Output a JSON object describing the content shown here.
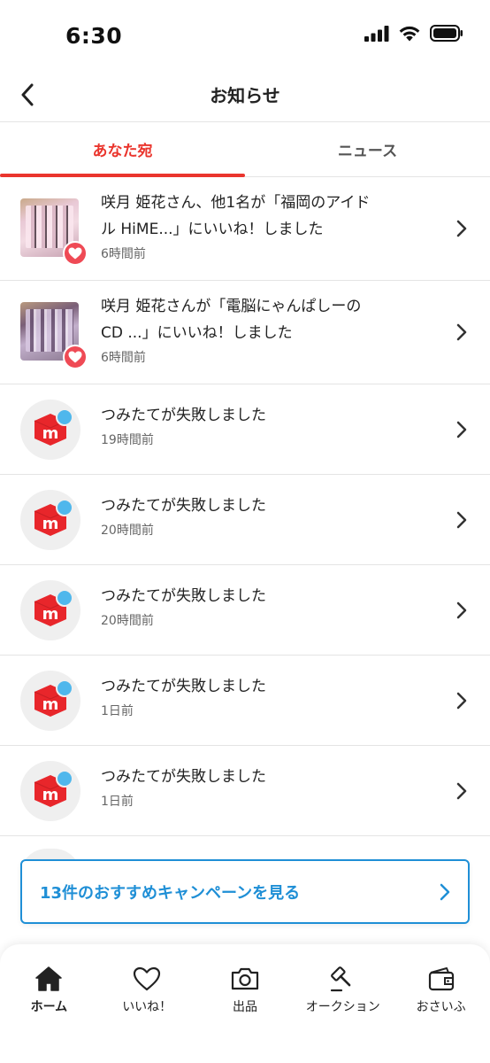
{
  "status_bar": {
    "time": "6:30"
  },
  "header": {
    "title": "お知らせ"
  },
  "tabs": [
    {
      "label": "あなた宛",
      "active": true
    },
    {
      "label": "ニュース",
      "active": false
    }
  ],
  "notifications": [
    {
      "kind": "like",
      "line1": "咲月 姫花さん、他1名が「福岡のアイド",
      "line2": "ル HiME...」にいいね！しました",
      "time": "6時間前"
    },
    {
      "kind": "like",
      "line1": "咲月 姫花さんが「電脳にゃんぱしーの",
      "line2": "CD ...」にいいね！しました",
      "time": "6時間前"
    },
    {
      "kind": "system",
      "line1": "つみたてが失敗しました",
      "time": "19時間前"
    },
    {
      "kind": "system",
      "line1": "つみたてが失敗しました",
      "time": "20時間前"
    },
    {
      "kind": "system",
      "line1": "つみたてが失敗しました",
      "time": "20時間前"
    },
    {
      "kind": "system",
      "line1": "つみたてが失敗しました",
      "time": "1日前"
    },
    {
      "kind": "system",
      "line1": "つみたてが失敗しました",
      "time": "1日前"
    }
  ],
  "campaign": {
    "label": "13件のおすすめキャンペーンを見る"
  },
  "bottom_nav": [
    {
      "label": "ホーム",
      "icon": "home-icon",
      "active": true
    },
    {
      "label": "いいね！",
      "icon": "heart-icon",
      "active": false
    },
    {
      "label": "出品",
      "icon": "camera-icon",
      "active": false
    },
    {
      "label": "オークション",
      "icon": "gavel-icon",
      "active": false
    },
    {
      "label": "おさいふ",
      "icon": "wallet-icon",
      "active": false
    }
  ],
  "colors": {
    "accent_red": "#ea352d",
    "link_blue": "#1f8fd6",
    "badge_blue": "#4fb7ec",
    "heart_red": "#ef4a55"
  }
}
